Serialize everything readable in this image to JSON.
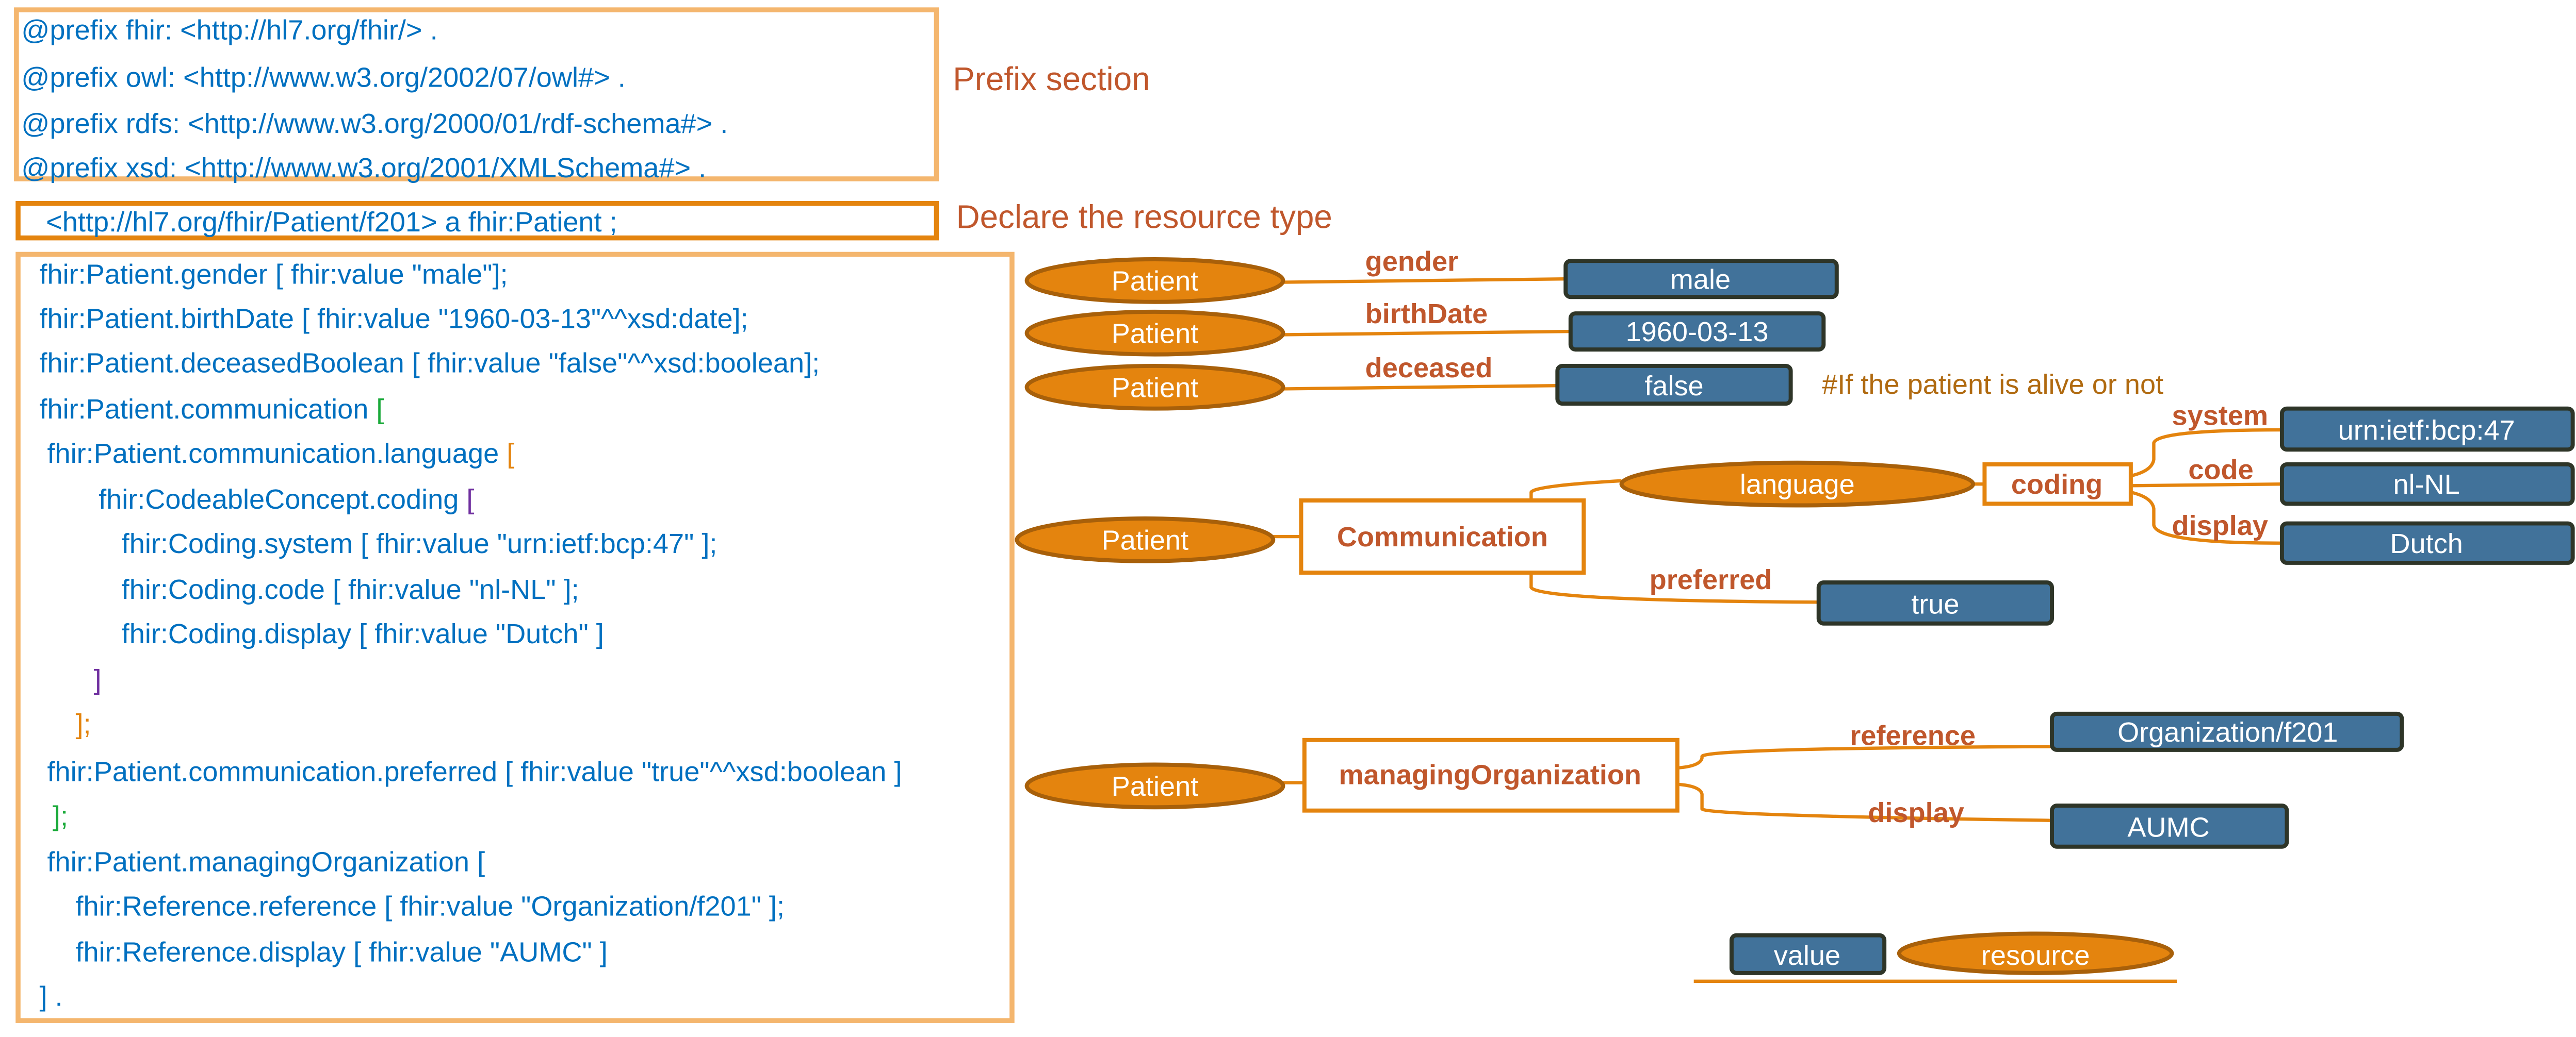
{
  "colors": {
    "code_text": "#0070C0",
    "annotation_text": "#C0572C",
    "comment_text": "#B06A10",
    "prefix_box_border": "#F4B66E",
    "declare_box_border": "#E4840E",
    "body_box_border": "#F4B66E",
    "resource_fill": "#E4840E",
    "resource_border": "#A8600A",
    "value_fill": "#41729A",
    "value_border": "#2E3528",
    "edge": "#E4840E",
    "bracket_green": "#1AAA3A",
    "bracket_orange": "#E4840E",
    "bracket_purple": "#7030A0"
  },
  "prefix_section": {
    "lines": [
      "@prefix fhir: <http://hl7.org/fhir/> .",
      "@prefix owl: <http://www.w3.org/2002/07/owl#> .",
      "@prefix rdfs: <http://www.w3.org/2000/01/rdf-schema#> .",
      "@prefix xsd: <http://www.w3.org/2001/XMLSchema#> ."
    ],
    "label": "Prefix section"
  },
  "declare_section": {
    "line": "<http://hl7.org/fhir/Patient/f201> a fhir:Patient ;",
    "label": "Declare the resource type"
  },
  "body_section": {
    "lines": [
      {
        "text": "fhir:Patient.gender [ fhir:value \"male\"];",
        "bracket": "",
        "bracket_color": ""
      },
      {
        "text": "fhir:Patient.birthDate [ fhir:value \"1960-03-13\"^^xsd:date];",
        "bracket": "",
        "bracket_color": ""
      },
      {
        "text": "fhir:Patient.deceasedBoolean [ fhir:value \"false\"^^xsd:boolean];",
        "bracket": "",
        "bracket_color": ""
      },
      {
        "text": "fhir:Patient.communication ",
        "bracket": "[",
        "bracket_color": "green"
      },
      {
        "text": " fhir:Patient.communication.language ",
        "bracket": "[",
        "bracket_color": "orange"
      },
      {
        "text": "fhir:CodeableConcept.coding ",
        "bracket": "[",
        "bracket_color": "purple"
      },
      {
        "text": "fhir:Coding.system [ fhir:value \"urn:ietf:bcp:47\" ];",
        "bracket": "",
        "bracket_color": ""
      },
      {
        "text": "fhir:Coding.code [ fhir:value \"nl-NL\" ];",
        "bracket": "",
        "bracket_color": ""
      },
      {
        "text": "fhir:Coding.display [ fhir:value \"Dutch\" ]",
        "bracket": "",
        "bracket_color": ""
      },
      {
        "text": "",
        "bracket": "]",
        "bracket_color": "purple"
      },
      {
        "text": "",
        "bracket": "];",
        "bracket_color": "orange"
      },
      {
        "text": " fhir:Patient.communication.preferred [ fhir:value \"true\"^^xsd:boolean ]",
        "bracket": "",
        "bracket_color": ""
      },
      {
        "text": "",
        "bracket": "];",
        "bracket_color": "green"
      },
      {
        "text": " fhir:Patient.managingOrganization [",
        "bracket": "",
        "bracket_color": ""
      },
      {
        "text": "fhir:Reference.reference [ fhir:value \"Organization/f201\" ];",
        "bracket": "",
        "bracket_color": ""
      },
      {
        "text": "fhir:Reference.display [ fhir:value \"AUMC\" ]",
        "bracket": "",
        "bracket_color": ""
      },
      {
        "text": "] .",
        "bracket": "",
        "bracket_color": ""
      }
    ]
  },
  "graph": {
    "simple_triples": [
      {
        "subject": "Patient",
        "predicate": "gender",
        "object": "male"
      },
      {
        "subject": "Patient",
        "predicate": "birthDate",
        "object": "1960-03-13"
      },
      {
        "subject": "Patient",
        "predicate": "deceased",
        "object": "false"
      }
    ],
    "deceased_comment": "#If the patient is alive or not",
    "communication": {
      "subject": "Patient",
      "node": "Communication",
      "language_node": "language",
      "coding_node": "coding",
      "coding_edges": [
        {
          "predicate": "system",
          "object": "urn:ietf:bcp:47"
        },
        {
          "predicate": "code",
          "object": "nl-NL"
        },
        {
          "predicate": "display",
          "object": "Dutch"
        }
      ],
      "preferred_predicate": "preferred",
      "preferred_value": "true"
    },
    "managing_organization": {
      "subject": "Patient",
      "node": "managingOrganization",
      "edges": [
        {
          "predicate": "reference",
          "object": "Organization/f201"
        },
        {
          "predicate": "display",
          "object": "AUMC"
        }
      ]
    },
    "legend": {
      "value_label": "value",
      "resource_label": "resource"
    }
  }
}
